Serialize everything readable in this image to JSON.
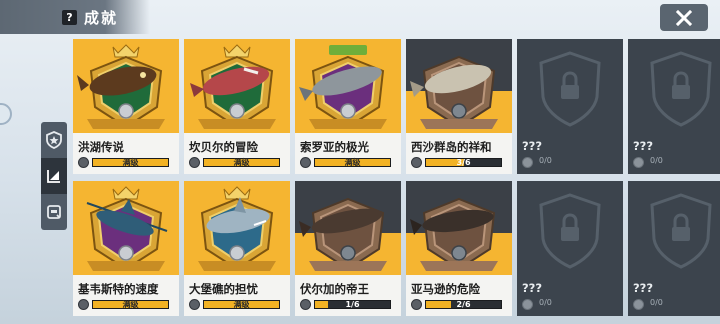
{
  "header": {
    "title": "成就",
    "help_icon": "help-icon"
  },
  "close": {
    "icon": "close-icon"
  },
  "side_nav": {
    "tabs": [
      "trophy-shield-icon",
      "fish-tab-icon",
      "record-tab-icon"
    ],
    "active": 1
  },
  "colors": {
    "gold": "#f5b531",
    "card_white": "#f4f4f2",
    "locked": "#3c444d",
    "header": "#5d6873"
  },
  "cards": [
    {
      "name": "洪湖传说",
      "progress_text": "满级",
      "progress": 1.0,
      "state": "max"
    },
    {
      "name": "坎贝尔的冒险",
      "progress_text": "满级",
      "progress": 1.0,
      "state": "max"
    },
    {
      "name": "索罗亚的极光",
      "progress_text": "满级",
      "progress": 1.0,
      "state": "max"
    },
    {
      "name": "西沙群岛的祥和",
      "progress_text": "3/6",
      "progress": 0.5,
      "state": "progress"
    },
    {
      "name": "???",
      "progress_text": "0/0",
      "progress": 0,
      "state": "locked"
    },
    {
      "name": "???",
      "progress_text": "0/0",
      "progress": 0,
      "state": "locked"
    },
    {
      "name": "基韦斯特的速度",
      "progress_text": "满级",
      "progress": 1.0,
      "state": "max"
    },
    {
      "name": "大堡礁的担忧",
      "progress_text": "满级",
      "progress": 1.0,
      "state": "max"
    },
    {
      "name": "伏尔加的帝王",
      "progress_text": "1/6",
      "progress": 0.1667,
      "state": "progress"
    },
    {
      "name": "亚马逊的危险",
      "progress_text": "2/6",
      "progress": 0.3333,
      "state": "progress"
    },
    {
      "name": "???",
      "progress_text": "0/0",
      "progress": 0,
      "state": "locked"
    },
    {
      "name": "???",
      "progress_text": "0/0",
      "progress": 0,
      "state": "locked"
    }
  ]
}
